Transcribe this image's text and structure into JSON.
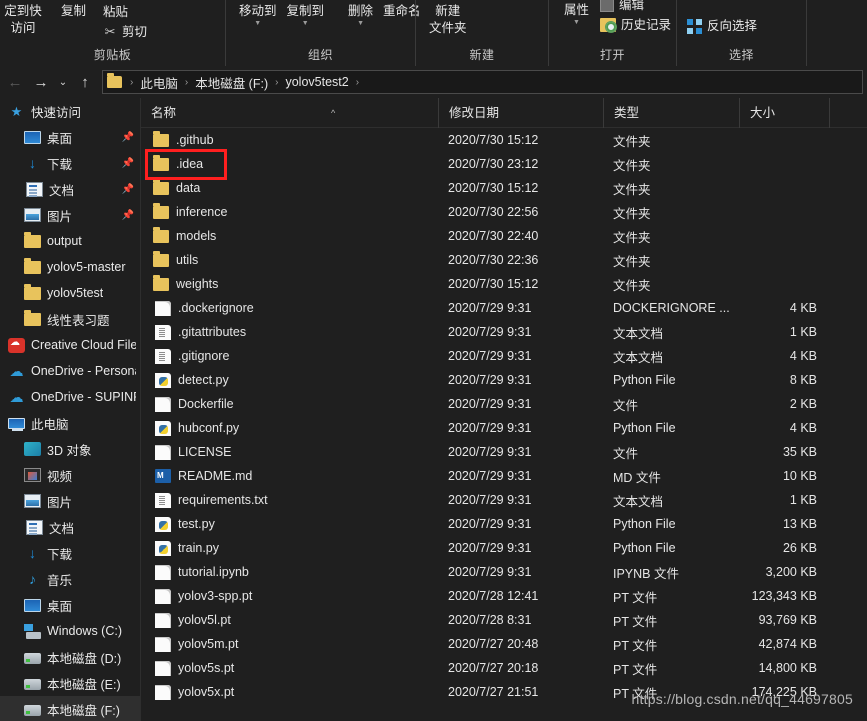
{
  "ribbon": {
    "groups": [
      {
        "caption": "剪贴板",
        "buttons": [
          {
            "label": "固定到快速访问",
            "line1": "定到快",
            "line2": "访问",
            "icon": "pin-to-quick-access-icon"
          },
          {
            "label": "复制",
            "icon": "copy-icon"
          },
          {
            "label": "粘贴",
            "icon": "paste-icon"
          },
          {
            "label": "剪切",
            "icon": "scissors-icon"
          }
        ]
      },
      {
        "caption": "组织",
        "buttons": [
          {
            "label": "移动到",
            "icon": "move-to-icon",
            "has_caret": true
          },
          {
            "label": "复制到",
            "icon": "copy-to-icon",
            "has_caret": true
          },
          {
            "label": "删除",
            "icon": "delete-icon",
            "has_caret": true
          },
          {
            "label": "重命名",
            "icon": "rename-icon",
            "has_caret": false
          }
        ]
      },
      {
        "caption": "新建",
        "buttons": [
          {
            "label": "新建文件夹",
            "line1": "新建",
            "line2": "文件夹",
            "icon": "new-folder-icon"
          }
        ]
      },
      {
        "caption": "打开",
        "buttons": [
          {
            "label": "属性",
            "icon": "properties-icon",
            "has_caret": true
          },
          {
            "label": "编辑",
            "icon": "edit-icon"
          },
          {
            "label": "历史记录",
            "icon": "history-icon"
          }
        ]
      },
      {
        "caption": "选择",
        "buttons": [
          {
            "label": "反向选择",
            "icon": "invert-selection-icon"
          }
        ]
      }
    ]
  },
  "navbar": {
    "back_icon": "back-arrow-icon",
    "forward_icon": "forward-arrow-icon",
    "recent_icon": "chevron-down-icon",
    "up_icon": "up-arrow-icon",
    "folder_icon": "folder-icon",
    "breadcrumbs": [
      "此电脑",
      "本地磁盘 (F:)",
      "yolov5test2"
    ],
    "separator": "›"
  },
  "sidebar": {
    "items": [
      {
        "label": "快速访问",
        "icon": "star-pin-icon",
        "level": 0,
        "pinned": false,
        "selected": false
      },
      {
        "label": "桌面",
        "icon": "desktop-icon",
        "level": 1,
        "pinned": true,
        "selected": false
      },
      {
        "label": "下载",
        "icon": "download-icon",
        "level": 1,
        "pinned": true,
        "selected": false
      },
      {
        "label": "文档",
        "icon": "documents-icon",
        "level": 1,
        "pinned": true,
        "selected": false
      },
      {
        "label": "图片",
        "icon": "pictures-icon",
        "level": 1,
        "pinned": true,
        "selected": false
      },
      {
        "label": "output",
        "icon": "folder-icon",
        "level": 1,
        "pinned": false,
        "selected": false
      },
      {
        "label": "yolov5-master",
        "icon": "folder-icon",
        "level": 1,
        "pinned": false,
        "selected": false
      },
      {
        "label": "yolov5test",
        "icon": "folder-icon",
        "level": 1,
        "pinned": false,
        "selected": false
      },
      {
        "label": "线性表习题",
        "icon": "folder-icon",
        "level": 1,
        "pinned": false,
        "selected": false
      },
      {
        "label": "Creative Cloud Files",
        "icon": "creative-cloud-icon",
        "level": 0,
        "pinned": false,
        "selected": false
      },
      {
        "label": "OneDrive - Personal",
        "icon": "onedrive-icon",
        "level": 0,
        "pinned": false,
        "selected": false
      },
      {
        "label": "OneDrive - SUPINFO",
        "icon": "onedrive-icon",
        "level": 0,
        "pinned": false,
        "selected": false
      },
      {
        "label": "此电脑",
        "icon": "this-pc-icon",
        "level": 0,
        "pinned": false,
        "selected": false
      },
      {
        "label": "3D 对象",
        "icon": "3d-objects-icon",
        "level": 1,
        "pinned": false,
        "selected": false
      },
      {
        "label": "视频",
        "icon": "videos-icon",
        "level": 1,
        "pinned": false,
        "selected": false
      },
      {
        "label": "图片",
        "icon": "pictures-icon",
        "level": 1,
        "pinned": false,
        "selected": false
      },
      {
        "label": "文档",
        "icon": "documents-icon",
        "level": 1,
        "pinned": false,
        "selected": false
      },
      {
        "label": "下载",
        "icon": "download-icon",
        "level": 1,
        "pinned": false,
        "selected": false
      },
      {
        "label": "音乐",
        "icon": "music-icon",
        "level": 1,
        "pinned": false,
        "selected": false
      },
      {
        "label": "桌面",
        "icon": "desktop-icon",
        "level": 1,
        "pinned": false,
        "selected": false
      },
      {
        "label": "Windows (C:)",
        "icon": "windows-drive-icon",
        "level": 1,
        "pinned": false,
        "selected": false
      },
      {
        "label": "本地磁盘 (D:)",
        "icon": "drive-icon",
        "level": 1,
        "pinned": false,
        "selected": false
      },
      {
        "label": "本地磁盘 (E:)",
        "icon": "drive-icon",
        "level": 1,
        "pinned": false,
        "selected": false
      },
      {
        "label": "本地磁盘 (F:)",
        "icon": "drive-icon",
        "level": 1,
        "pinned": false,
        "selected": true
      }
    ]
  },
  "filelist": {
    "columns": [
      "名称",
      "修改日期",
      "类型",
      "大小"
    ],
    "sort_indicator": "^",
    "rows": [
      {
        "name": ".github",
        "date": "2020/7/30 15:12",
        "type": "文件夹",
        "size": "",
        "icon": "folder-icon"
      },
      {
        "name": ".idea",
        "date": "2020/7/30 23:12",
        "type": "文件夹",
        "size": "",
        "icon": "folder-icon",
        "annotated": true
      },
      {
        "name": "data",
        "date": "2020/7/30 15:12",
        "type": "文件夹",
        "size": "",
        "icon": "folder-icon"
      },
      {
        "name": "inference",
        "date": "2020/7/30 22:56",
        "type": "文件夹",
        "size": "",
        "icon": "folder-icon"
      },
      {
        "name": "models",
        "date": "2020/7/30 22:40",
        "type": "文件夹",
        "size": "",
        "icon": "folder-icon"
      },
      {
        "name": "utils",
        "date": "2020/7/30 22:36",
        "type": "文件夹",
        "size": "",
        "icon": "folder-icon"
      },
      {
        "name": "weights",
        "date": "2020/7/30 15:12",
        "type": "文件夹",
        "size": "",
        "icon": "folder-icon"
      },
      {
        "name": ".dockerignore",
        "date": "2020/7/29 9:31",
        "type": "DOCKERIGNORE ...",
        "size": "4 KB",
        "icon": "blank-file-icon"
      },
      {
        "name": ".gitattributes",
        "date": "2020/7/29 9:31",
        "type": "文本文档",
        "size": "1 KB",
        "icon": "text-file-icon"
      },
      {
        "name": ".gitignore",
        "date": "2020/7/29 9:31",
        "type": "文本文档",
        "size": "4 KB",
        "icon": "text-file-icon"
      },
      {
        "name": "detect.py",
        "date": "2020/7/29 9:31",
        "type": "Python File",
        "size": "8 KB",
        "icon": "python-file-icon"
      },
      {
        "name": "Dockerfile",
        "date": "2020/7/29 9:31",
        "type": "文件",
        "size": "2 KB",
        "icon": "blank-file-icon"
      },
      {
        "name": "hubconf.py",
        "date": "2020/7/29 9:31",
        "type": "Python File",
        "size": "4 KB",
        "icon": "python-file-icon"
      },
      {
        "name": "LICENSE",
        "date": "2020/7/29 9:31",
        "type": "文件",
        "size": "35 KB",
        "icon": "blank-file-icon"
      },
      {
        "name": "README.md",
        "date": "2020/7/29 9:31",
        "type": "MD 文件",
        "size": "10 KB",
        "icon": "markdown-file-icon"
      },
      {
        "name": "requirements.txt",
        "date": "2020/7/29 9:31",
        "type": "文本文档",
        "size": "1 KB",
        "icon": "text-file-icon"
      },
      {
        "name": "test.py",
        "date": "2020/7/29 9:31",
        "type": "Python File",
        "size": "13 KB",
        "icon": "python-file-icon"
      },
      {
        "name": "train.py",
        "date": "2020/7/29 9:31",
        "type": "Python File",
        "size": "26 KB",
        "icon": "python-file-icon"
      },
      {
        "name": "tutorial.ipynb",
        "date": "2020/7/29 9:31",
        "type": "IPYNB 文件",
        "size": "3,200 KB",
        "icon": "blank-file-icon"
      },
      {
        "name": "yolov3-spp.pt",
        "date": "2020/7/28 12:41",
        "type": "PT 文件",
        "size": "123,343 KB",
        "icon": "blank-file-icon"
      },
      {
        "name": "yolov5l.pt",
        "date": "2020/7/28 8:31",
        "type": "PT 文件",
        "size": "93,769 KB",
        "icon": "blank-file-icon"
      },
      {
        "name": "yolov5m.pt",
        "date": "2020/7/27 20:48",
        "type": "PT 文件",
        "size": "42,874 KB",
        "icon": "blank-file-icon"
      },
      {
        "name": "yolov5s.pt",
        "date": "2020/7/27 20:18",
        "type": "PT 文件",
        "size": "14,800 KB",
        "icon": "blank-file-icon"
      },
      {
        "name": "yolov5x.pt",
        "date": "2020/7/27 21:51",
        "type": "PT 文件",
        "size": "174,225 KB",
        "icon": "blank-file-icon"
      }
    ]
  },
  "watermark": "https://blog.csdn.net/qq_44697805",
  "colors": {
    "background": "#1f1f1f",
    "text": "#e6e6e6",
    "folder": "#e8c35c",
    "accent": "#2f8ad6",
    "annotation": "#ff1f1f",
    "selected_row": "#2f2f2f"
  }
}
